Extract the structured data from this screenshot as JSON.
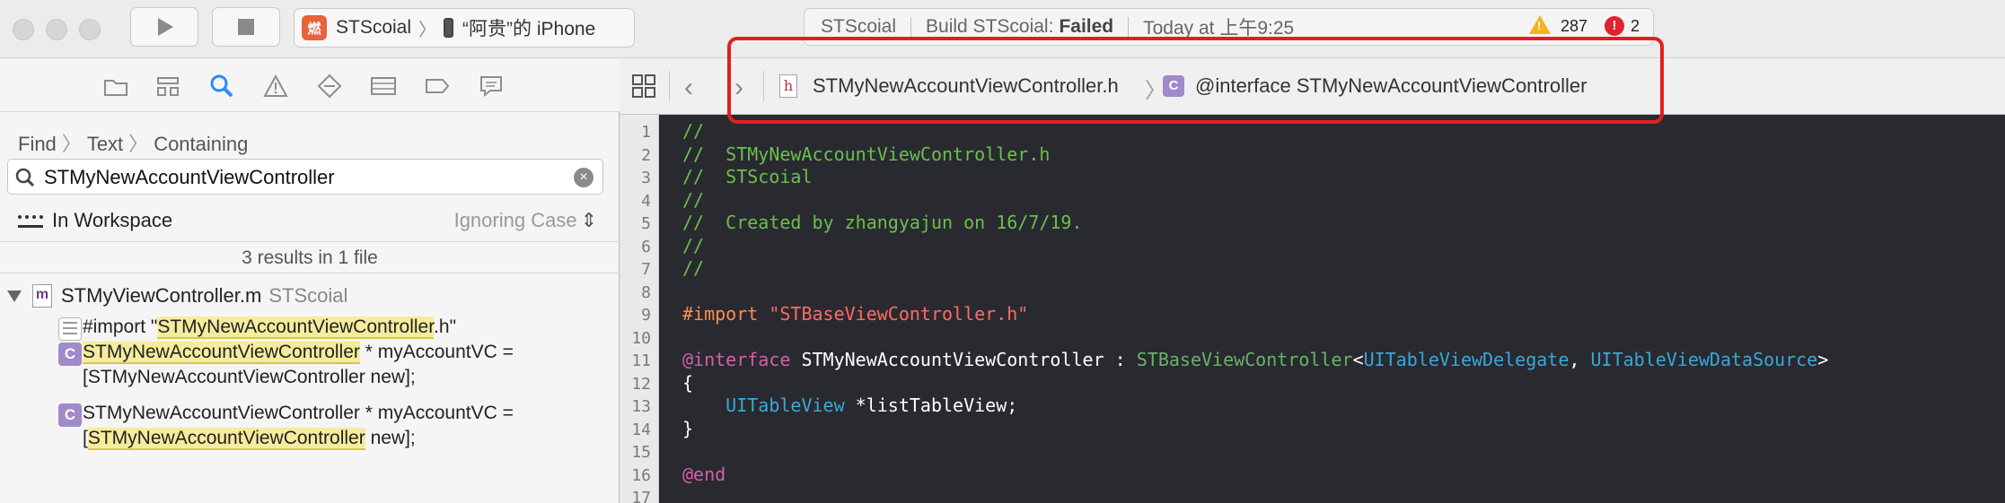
{
  "toolbar": {
    "scheme_icon_glyph": "燃",
    "scheme_name": "STScoial",
    "device": "“阿贵”的 iPhone",
    "activity": {
      "project": "STScoial",
      "build_prefix": "Build STScoial:",
      "build_status": "Failed",
      "time": "Today at 上午9:25",
      "warnings": "287",
      "errors": "2"
    }
  },
  "find": {
    "path": [
      "Find",
      "Text",
      "Containing"
    ],
    "query": "STMyNewAccountViewController",
    "scope": "In Workspace",
    "options": "Ignoring Case",
    "summary": "3 results in 1 file",
    "file": {
      "icon": "m",
      "name": "STMyViewController.m",
      "project": "STScoial"
    },
    "results": [
      {
        "icon": "text",
        "lines": [
          [
            "#import \"",
            "STMyNewAccountViewController",
            ".h\""
          ]
        ]
      },
      {
        "icon": "C",
        "lines": [
          [
            "",
            "STMyNewAccountViewController",
            " * myAccountVC ="
          ],
          [
            "[STMyNewAccountViewController new];",
            "",
            ""
          ]
        ]
      },
      {
        "icon": "C",
        "lines": [
          [
            "STMyNewAccountViewController * myAccountVC =",
            "",
            ""
          ],
          [
            "[",
            "STMyNewAccountViewController",
            " new];"
          ]
        ]
      }
    ]
  },
  "jumpbar": {
    "file_icon": "h",
    "file": "STMyNewAccountViewController.h",
    "symbol_icon": "C",
    "symbol": "@interface STMyNewAccountViewController"
  },
  "code": {
    "line_numbers": [
      "1",
      "2",
      "3",
      "4",
      "5",
      "6",
      "7",
      "8",
      "9",
      "10",
      "11",
      "12",
      "13",
      "14",
      "15",
      "16",
      "17"
    ],
    "lines": [
      [
        [
          "cm",
          "//"
        ]
      ],
      [
        [
          "cm",
          "//  STMyNewAccountViewController.h"
        ]
      ],
      [
        [
          "cm",
          "//  STScoial"
        ]
      ],
      [
        [
          "cm",
          "//"
        ]
      ],
      [
        [
          "cm",
          "//  Created by zhangyajun on 16/7/19."
        ]
      ],
      [
        [
          "cm",
          "//"
        ]
      ],
      [
        [
          "cm",
          "//"
        ]
      ],
      [],
      [
        [
          "pp",
          "#import "
        ],
        [
          "st",
          "\"STBaseViewController.h\""
        ]
      ],
      [],
      [
        [
          "kw",
          "@interface"
        ],
        [
          "pl",
          " STMyNewAccountViewController : "
        ],
        [
          "ty",
          "STBaseViewController"
        ],
        [
          "pl",
          "<"
        ],
        [
          "fw",
          "UITableViewDelegate"
        ],
        [
          "pl",
          ", "
        ],
        [
          "fw",
          "UITableViewDataSource"
        ],
        [
          "pl",
          ">"
        ]
      ],
      [
        [
          "pl",
          "{"
        ]
      ],
      [
        [
          "pl",
          "    "
        ],
        [
          "fw",
          "UITableView"
        ],
        [
          "pl",
          " *listTableView;"
        ]
      ],
      [
        [
          "pl",
          "}"
        ]
      ],
      [],
      [
        [
          "kw",
          "@end"
        ]
      ],
      []
    ]
  },
  "icons": [
    "play-icon",
    "stop-icon",
    "folder-icon",
    "hierarchy-icon",
    "search-icon",
    "warning-icon",
    "diamond-icon",
    "list-icon",
    "tag-icon",
    "chat-icon",
    "grid-icon",
    "back-icon",
    "forward-icon"
  ]
}
